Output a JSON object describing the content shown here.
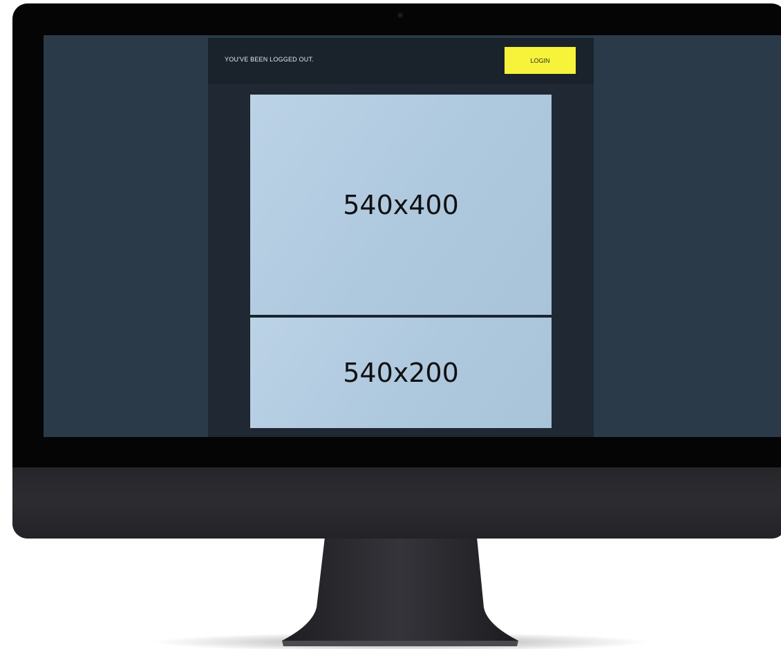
{
  "topbar": {
    "message": "YOU'VE BEEN LOGGED OUT.",
    "login_label": "LOGIN"
  },
  "placeholders": {
    "large": "540x400",
    "small": "540x200"
  },
  "colors": {
    "login_button": "#f6f33a",
    "screen_background": "#2a3a48",
    "page_background": "#1f2833",
    "placeholder": "#b3cbe0"
  }
}
